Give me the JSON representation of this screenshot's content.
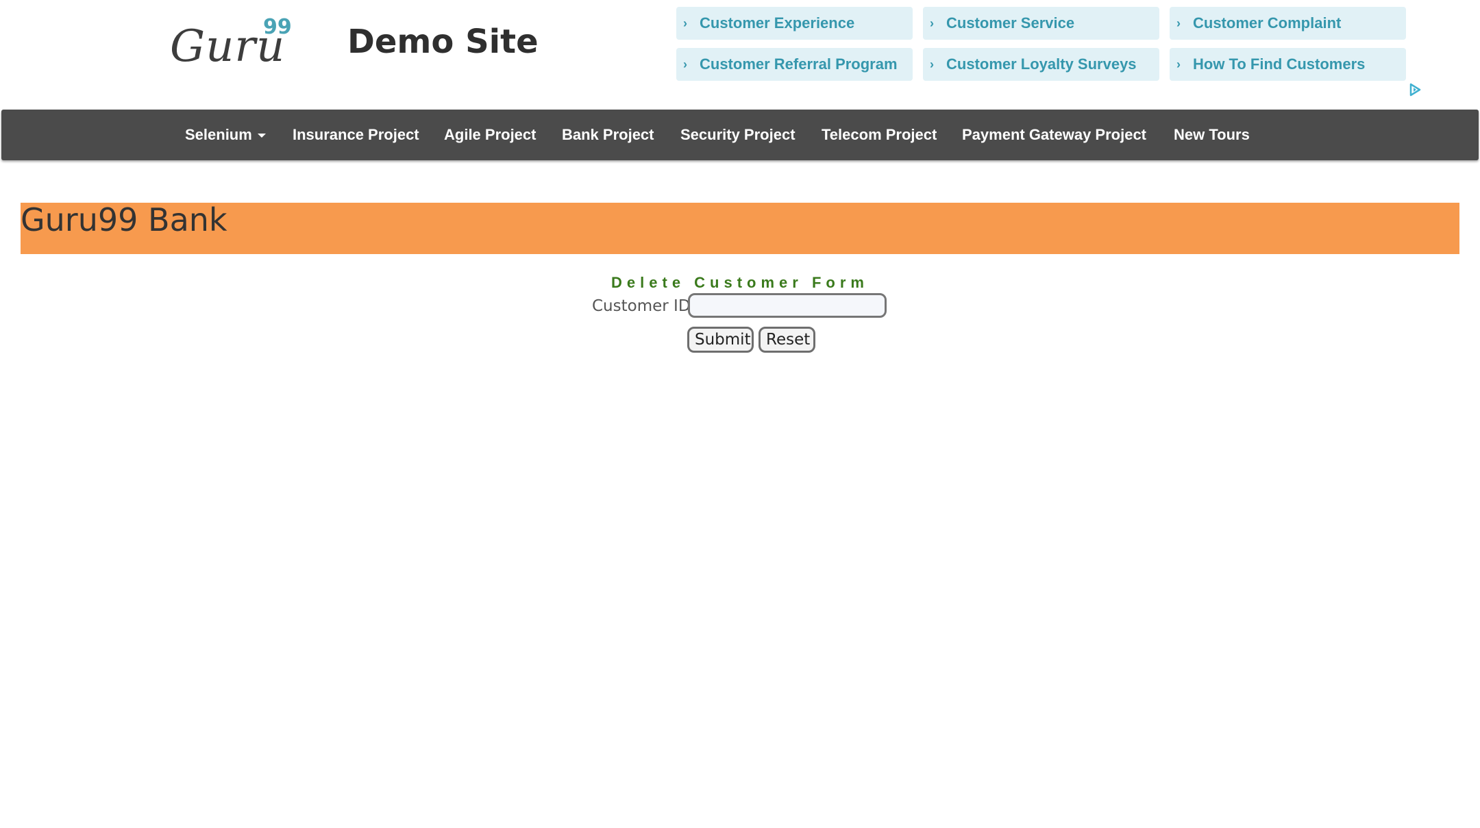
{
  "header": {
    "logo_text": "Guru",
    "logo_superscript": "99",
    "site_title": "Demo Site"
  },
  "ads": {
    "links": [
      "Customer Experience",
      "Customer Service",
      "Customer Complaint",
      "Customer Referral Program",
      "Customer Loyalty Surveys",
      "How To Find Customers"
    ],
    "chevron": "›",
    "adchoices_icon": "adchoices-triangle-icon"
  },
  "nav": {
    "items": [
      "Selenium",
      "Insurance Project",
      "Agile Project",
      "Bank Project",
      "Security Project",
      "Telecom Project",
      "Payment Gateway Project",
      "New Tours"
    ]
  },
  "banner": {
    "title": "Guru99 Bank"
  },
  "form": {
    "heading": "Delete Customer Form",
    "customer_id_label": "Customer ID",
    "customer_id_value": "",
    "submit_label": "Submit",
    "reset_label": "Reset"
  },
  "colors": {
    "nav_bg": "#4b4b4b",
    "banner_bg": "#f79a4e",
    "ad_bg": "#e1f1f6",
    "ad_text": "#3597ad",
    "heading_green": "#3a7a1c"
  }
}
